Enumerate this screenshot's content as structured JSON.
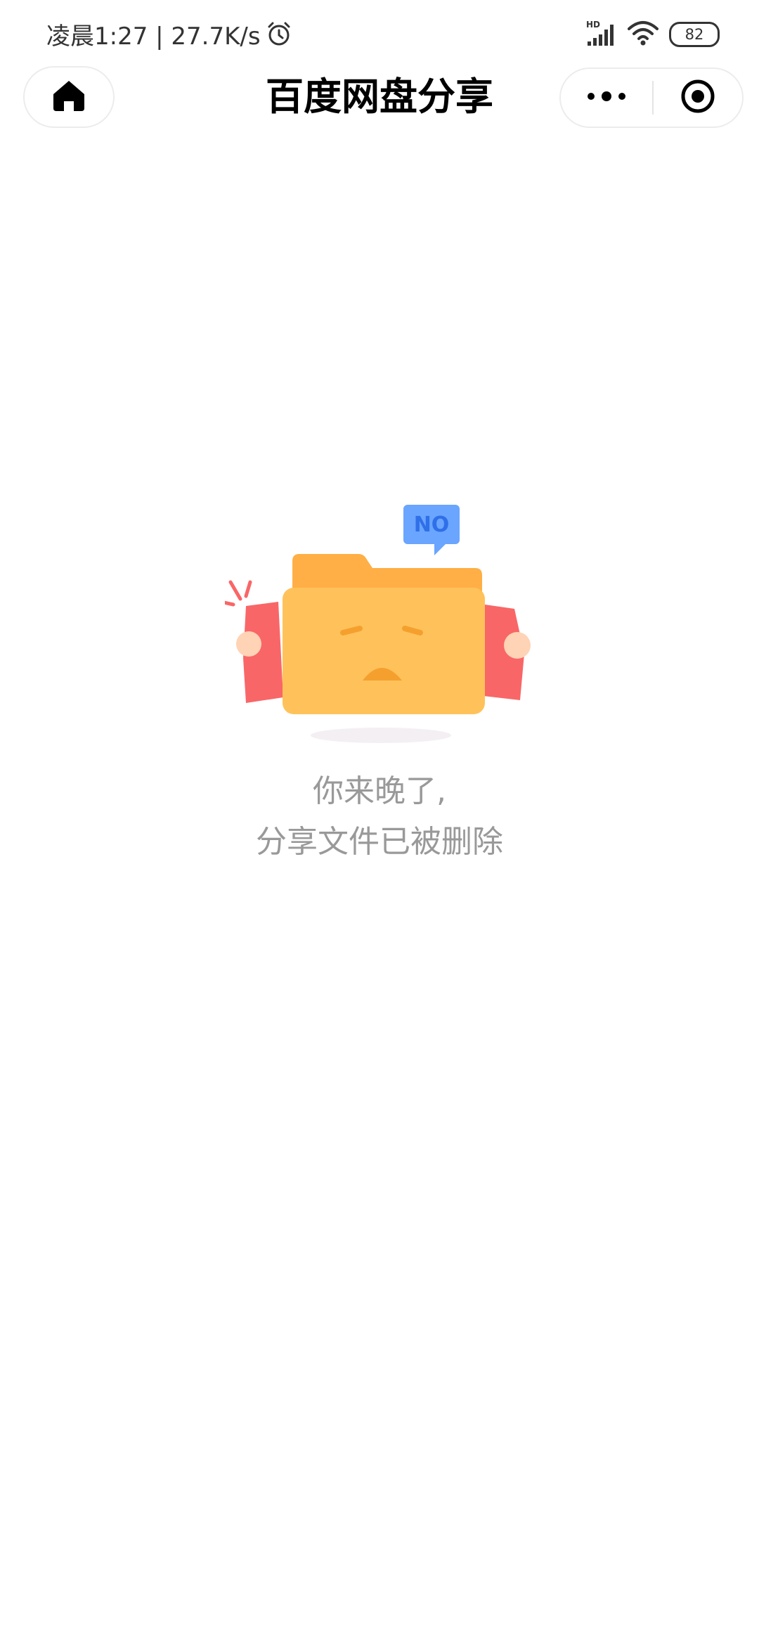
{
  "status_bar": {
    "time_text": "凌晨1:27 | 27.7K/s",
    "network_badge": "HD",
    "battery_level": "82",
    "icons": [
      "alarm-icon",
      "signal-icon",
      "wifi-icon",
      "battery-icon"
    ]
  },
  "nav": {
    "title": "百度网盘分享",
    "icons": [
      "home-icon",
      "more-icon",
      "close-target-icon"
    ]
  },
  "illustration": {
    "speech_bubble": "NO"
  },
  "empty_state": {
    "line1": "你来晚了,",
    "line2": "分享文件已被删除"
  },
  "colors": {
    "folder_body": "#FFC25A",
    "folder_tab": "#FFAF45",
    "paper_red": "#F96667",
    "bubble_blue": "#6AA5FF",
    "message_gray": "#999999"
  }
}
